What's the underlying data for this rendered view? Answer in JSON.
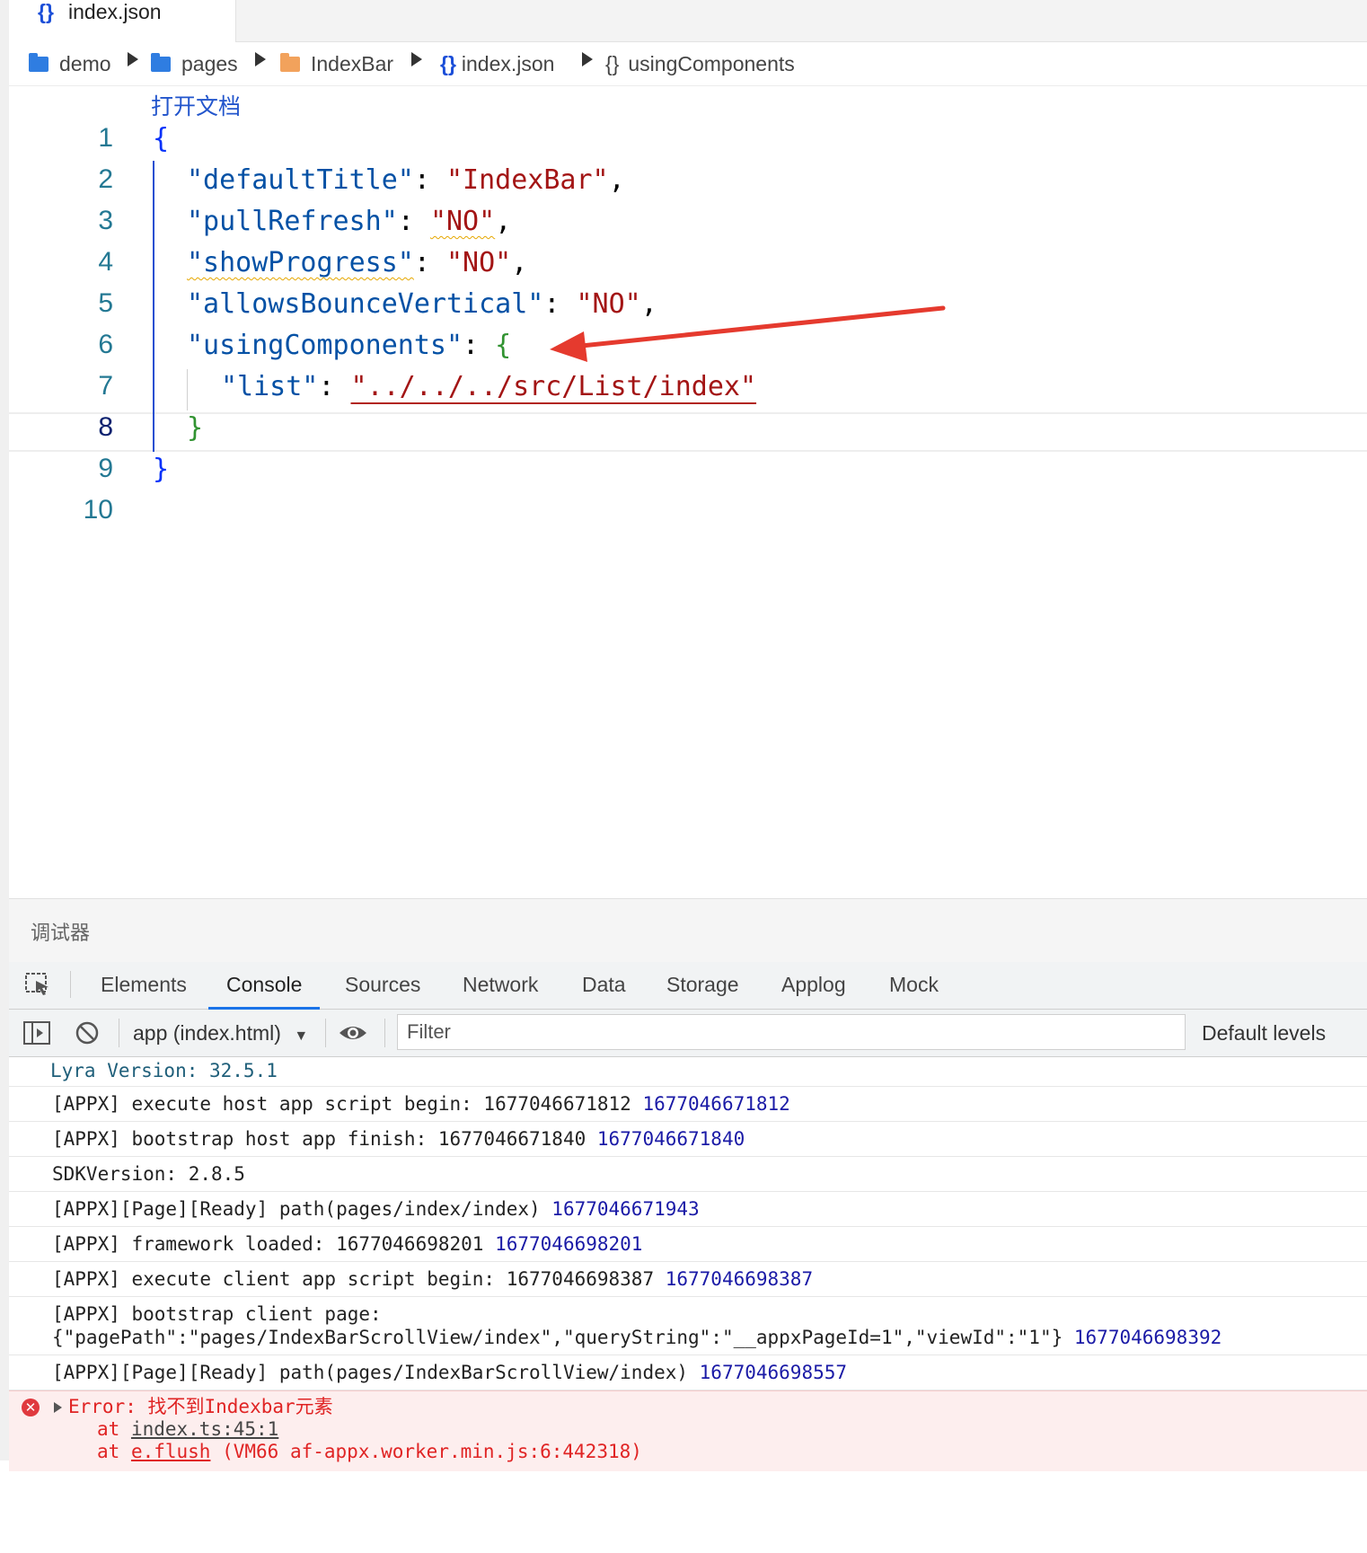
{
  "editor": {
    "tab": {
      "icon": "{}",
      "label": "index.json"
    },
    "breadcrumb": [
      {
        "label": "demo",
        "icon": "folder-icon"
      },
      {
        "label": "pages",
        "icon": "folder-icon"
      },
      {
        "label": "IndexBar",
        "icon": "folder-icon"
      },
      {
        "label": "index.json",
        "icon": "json-file-icon"
      },
      {
        "label": "usingComponents",
        "icon": "object-icon"
      }
    ],
    "breadcrumb_icons": {
      "json": "{}",
      "object": "{}"
    },
    "codelens": "打开文档",
    "line_numbers": [
      "1",
      "2",
      "3",
      "4",
      "5",
      "6",
      "7",
      "8",
      "9",
      "10"
    ],
    "active_line": "8",
    "code": {
      "l1_open": "{",
      "l2_key": "\"defaultTitle\"",
      "l2_val": "\"IndexBar\"",
      "l3_key": "\"pullRefresh\"",
      "l3_val": "\"NO\"",
      "l4_key": "\"showProgress\"",
      "l4_val": "\"NO\"",
      "l5_key": "\"allowsBounceVertical\"",
      "l5_val": "\"NO\"",
      "l6_key": "\"usingComponents\"",
      "l6_open": "{",
      "l7_key": "\"list\"",
      "l7_val": "\"../../../src/List/index\"",
      "l8_close": "}",
      "l9_close": "}",
      "colon": ":",
      "comma": ","
    }
  },
  "debugger": {
    "title": "调试器",
    "tabs": [
      "Elements",
      "Console",
      "Sources",
      "Network",
      "Data",
      "Storage",
      "Applog",
      "Mock"
    ],
    "active_tab": "Console",
    "toolbar": {
      "context": "app (index.html)",
      "filter_placeholder": "Filter",
      "levels": "Default levels"
    },
    "console": {
      "version": "Lyra Version: 32.5.1",
      "rows": [
        {
          "text": "[APPX] execute host app script begin: 1677046671812 ",
          "num": "1677046671812"
        },
        {
          "text": "[APPX] bootstrap host app finish: 1677046671840 ",
          "num": "1677046671840"
        },
        {
          "text": "SDKVersion: 2.8.5",
          "num": ""
        },
        {
          "text": "[APPX][Page][Ready] path(pages/index/index) ",
          "num": "1677046671943"
        },
        {
          "text": "[APPX] framework loaded: 1677046698201 ",
          "num": "1677046698201"
        },
        {
          "text": "[APPX] execute client app script begin: 1677046698387 ",
          "num": "1677046698387"
        }
      ],
      "bootstrap_line1": "[APPX] bootstrap client page:",
      "bootstrap_line2": "{\"pagePath\":\"pages/IndexBarScrollView/index\",\"queryString\":\"__appxPageId=1\",\"viewId\":\"1\"} ",
      "bootstrap_num": "1677046698392",
      "ready2": "[APPX][Page][Ready] path(pages/IndexBarScrollView/index) ",
      "ready2_num": "1677046698557",
      "error": {
        "message": "Error: 找不到Indexbar元素",
        "at1_prefix": "at ",
        "at1_link": "index.ts:45:1",
        "at2_prefix": "at ",
        "at2_link": "e.flush",
        "at2_rest": " (VM66 af-appx.worker.min.js:6:442318)"
      }
    }
  },
  "colors": {
    "accent": "#1a73e8",
    "annotation_arrow": "#e53a2e",
    "error_text": "#e02424",
    "error_bg": "#fdeeee"
  }
}
